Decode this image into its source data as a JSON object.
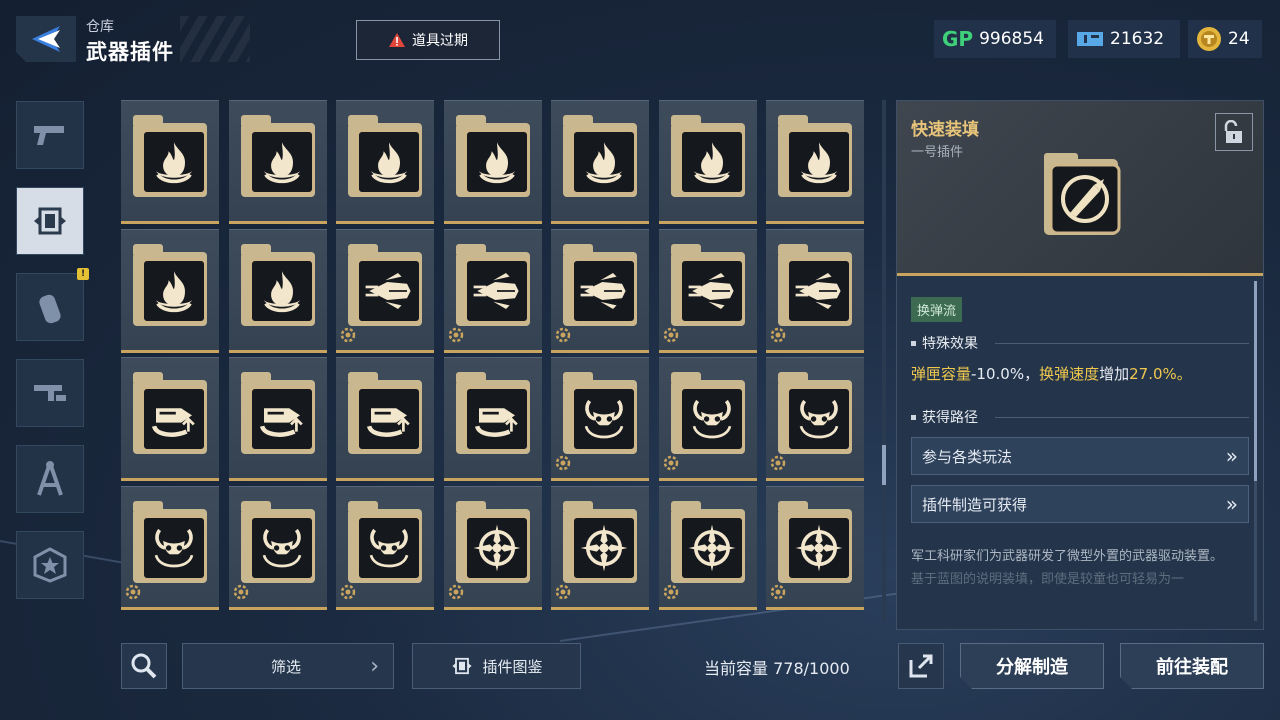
{
  "header": {
    "crumb": "仓库",
    "title": "武器插件",
    "alert": "道具过期"
  },
  "currency": [
    {
      "icon": "gp-icon",
      "value": "996854"
    },
    {
      "icon": "ticket-icon",
      "value": "21632"
    },
    {
      "icon": "coin-icon",
      "value": "24"
    }
  ],
  "left_tabs": [
    {
      "name": "pistol-icon",
      "active": false
    },
    {
      "name": "plugin-icon",
      "active": true
    },
    {
      "name": "grenade-icon",
      "active": false,
      "badge": "!"
    },
    {
      "name": "gun-part-icon",
      "active": false
    },
    {
      "name": "compass-icon",
      "active": false
    },
    {
      "name": "star-badge-icon",
      "active": false
    }
  ],
  "grid": [
    [
      "flame",
      "flame",
      "flame",
      "flame",
      "flame",
      "flame",
      "flame"
    ],
    [
      "flame",
      "flame",
      "rocket",
      "rocket",
      "rocket",
      "rocket",
      "rocket"
    ],
    [
      "bullet",
      "bullet",
      "bullet",
      "bullet",
      "demon",
      "demon",
      "demon"
    ],
    [
      "demon",
      "demon",
      "demon",
      "target",
      "target",
      "target",
      "target"
    ]
  ],
  "grid_gear": [
    [
      false,
      false,
      false,
      false,
      false,
      false,
      false
    ],
    [
      false,
      false,
      true,
      true,
      true,
      true,
      true
    ],
    [
      false,
      false,
      false,
      false,
      true,
      true,
      true
    ],
    [
      true,
      true,
      true,
      true,
      true,
      true,
      true
    ]
  ],
  "detail": {
    "name": "快速装填",
    "subtitle": "一号插件",
    "tag": "换弹流",
    "effect_title": "特殊效果",
    "effect_a": "弹匣容量",
    "effect_b": "-10.0%，",
    "effect_c": "换弹速度",
    "effect_d": "增加",
    "effect_e": "27.0%。",
    "source_title": "获得路径",
    "sources": [
      "参与各类玩法",
      "插件制造可获得"
    ],
    "desc1": "军工科研家们为武器研发了微型外置的武器驱动装置。",
    "desc2": "基于蓝图的说明装填，即使是较童也可轻易为一"
  },
  "bottom": {
    "filter": "筛选",
    "catalog": "插件图鉴",
    "capacity_label": "当前容量",
    "capacity": "778/1000",
    "dismantle": "分解制造",
    "equip": "前往装配"
  },
  "colors": {
    "gold": "#c8a45e",
    "accent_yellow": "#f0c84f",
    "tag_green": "#3c6b52"
  }
}
